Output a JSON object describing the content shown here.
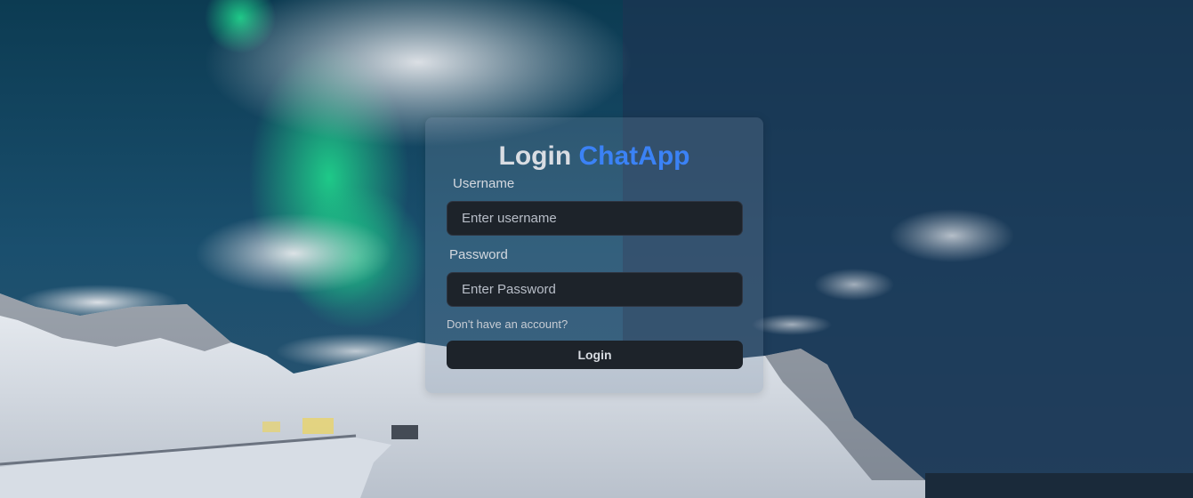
{
  "login": {
    "title_prefix": "Login ",
    "title_brand": "ChatApp",
    "username_label": "Username",
    "username_placeholder": "Enter username",
    "username_value": "",
    "password_label": "Password",
    "password_placeholder": "Enter Password",
    "password_value": "",
    "signup_link": "Don't have an account?",
    "submit_label": "Login"
  },
  "colors": {
    "brand": "#3b82f6",
    "input_bg": "#1d232a",
    "button_bg": "#1d232a"
  }
}
